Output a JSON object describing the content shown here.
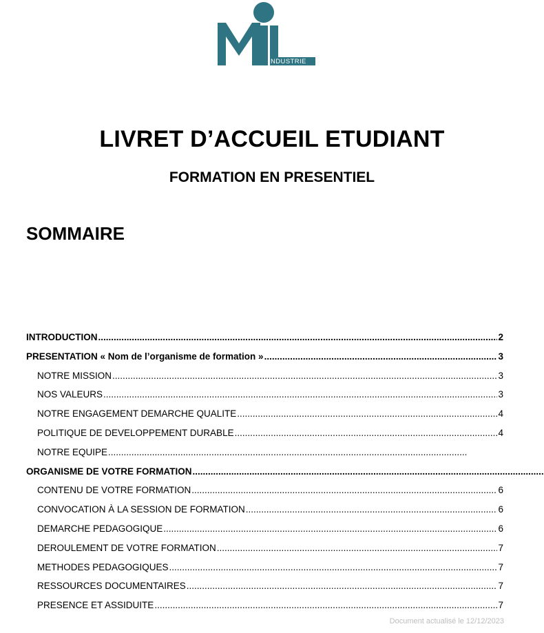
{
  "brand": {
    "logo_text": "IL",
    "logo_sub": "INDUSTRIE",
    "color": "#2e7482"
  },
  "title": "LIVRET D’ACCUEIL ETUDIANT",
  "subtitle": "FORMATION EN PRESENTIEL",
  "toc_heading": "SOMMAIRE",
  "toc": [
    {
      "label": "INTRODUCTION",
      "page": "2",
      "level": 1
    },
    {
      "label": "PRESENTATION « Nom de l’organisme de formation »",
      "page": "3",
      "level": 1
    },
    {
      "label": "NOTRE MISSION",
      "page": "3",
      "level": 2
    },
    {
      "label": "NOS VALEURS",
      "page": "3",
      "level": 2
    },
    {
      "label": "NOTRE ENGAGEMENT DEMARCHE QUALITE",
      "page": "4",
      "level": 2
    },
    {
      "label": "POLITIQUE DE DEVELOPPEMENT DURABLE",
      "page": "4",
      "level": 2
    },
    {
      "label": "NOTRE EQUIPE",
      "page": "",
      "level": 2
    },
    {
      "label": "ORGANISME DE VOTRE FORMATION",
      "page": "",
      "level": 1
    },
    {
      "label": "CONTENU DE VOTRE FORMATION",
      "page": "6",
      "level": 2
    },
    {
      "label": "CONVOCATION À LA SESSION DE FORMATION",
      "page": "6",
      "level": 2
    },
    {
      "label": "DEMARCHE PEDAGOGIQUE",
      "page": "6",
      "level": 2
    },
    {
      "label": "DEROULEMENT DE VOTRE FORMATION",
      "page": "7",
      "level": 2
    },
    {
      "label": "METHODES PEDAGOGIQUES",
      "page": "7",
      "level": 2
    },
    {
      "label": "RESSOURCES DOCUMENTAIRES",
      "page": "7",
      "level": 2
    },
    {
      "label": "PRESENCE ET ASSIDUITE",
      "page": "7",
      "level": 2
    }
  ],
  "footer_note": "Document actualisé le 12/12/2023"
}
